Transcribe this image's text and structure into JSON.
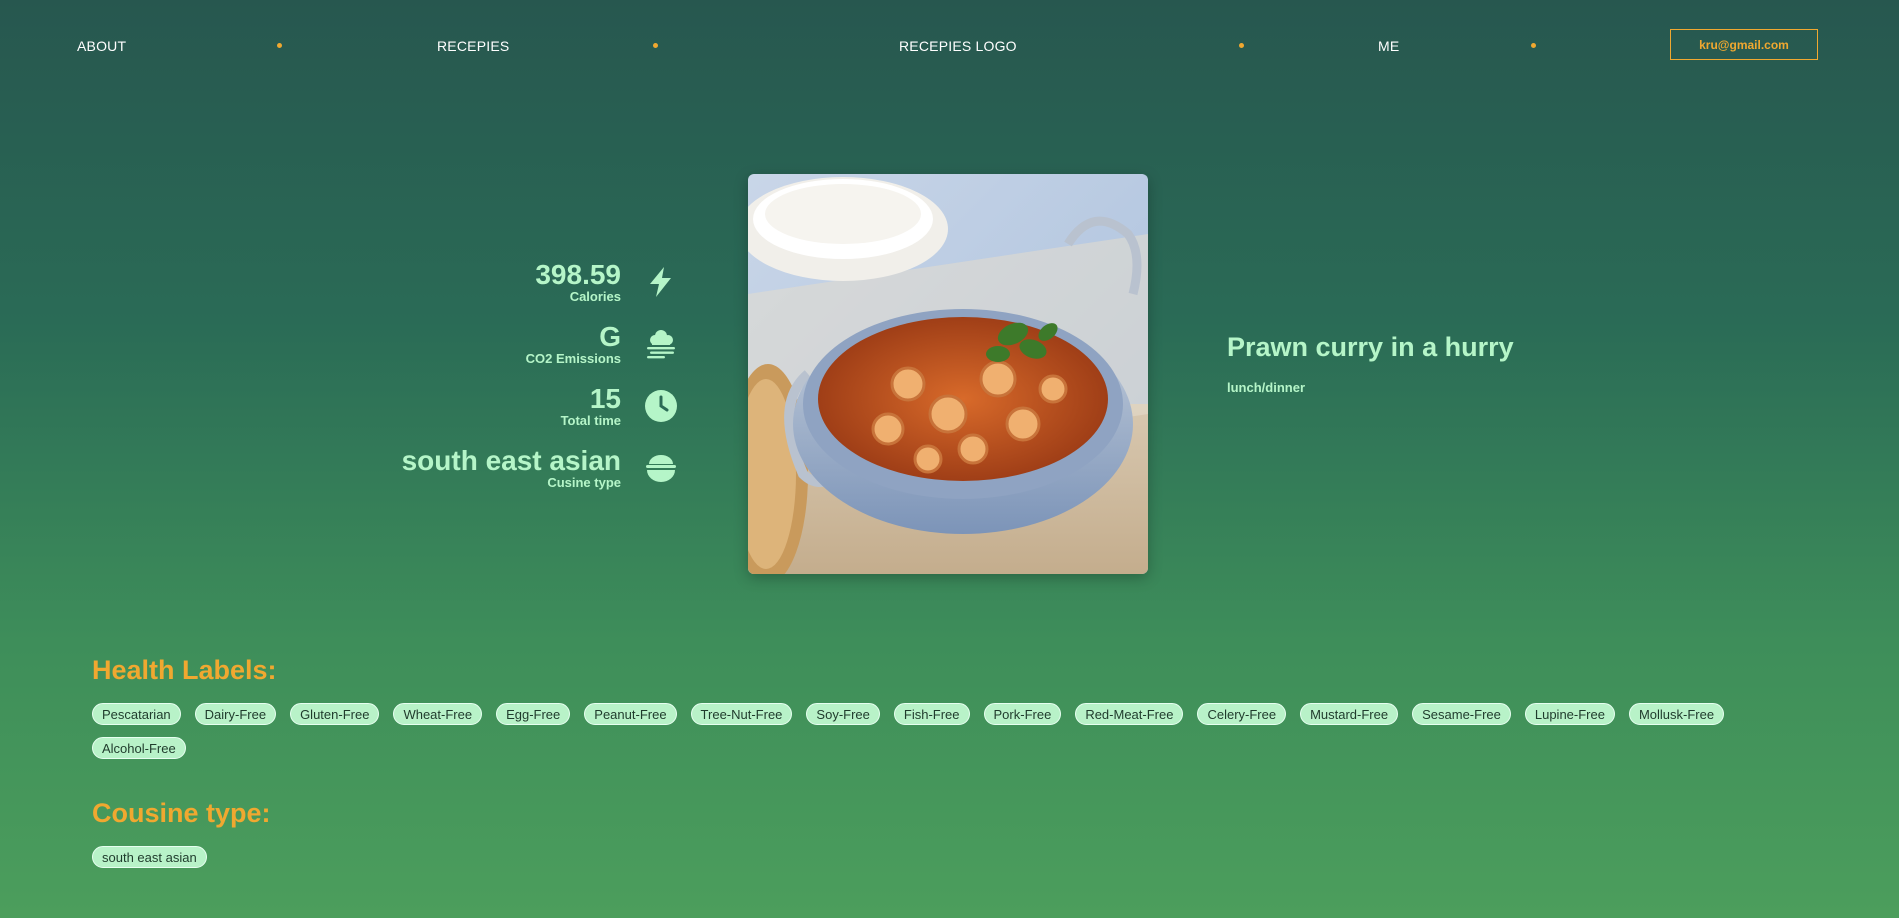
{
  "nav": {
    "about": "ABOUT",
    "recipes": "RECEPIES",
    "logo": "RECEPIES LOGO",
    "me": "ME",
    "email": "kru@gmail.com"
  },
  "colors": {
    "accent": "#f0a830",
    "mint": "#b5f5c8",
    "chip_bg": "#b8f2c8"
  },
  "stats": {
    "calories": {
      "value": "398.59",
      "label": "Calories",
      "icon": "lightning-icon"
    },
    "co2": {
      "value": "G",
      "label": "CO2 Emissions",
      "icon": "smog-icon"
    },
    "time": {
      "value": "15",
      "label": "Total time",
      "icon": "clock-icon"
    },
    "cuisine": {
      "value": "south east asian",
      "label": "Cusine type",
      "icon": "bowl-icon"
    }
  },
  "recipe": {
    "title": "Prawn curry in a hurry",
    "meal_type": "lunch/dinner"
  },
  "health": {
    "heading": "Health Labels:",
    "labels": [
      "Pescatarian",
      "Dairy-Free",
      "Gluten-Free",
      "Wheat-Free",
      "Egg-Free",
      "Peanut-Free",
      "Tree-Nut-Free",
      "Soy-Free",
      "Fish-Free",
      "Pork-Free",
      "Red-Meat-Free",
      "Celery-Free",
      "Mustard-Free",
      "Sesame-Free",
      "Lupine-Free",
      "Mollusk-Free",
      "Alcohol-Free"
    ]
  },
  "cuisine_section": {
    "heading": "Cousine type:",
    "labels": [
      "south east asian"
    ]
  }
}
